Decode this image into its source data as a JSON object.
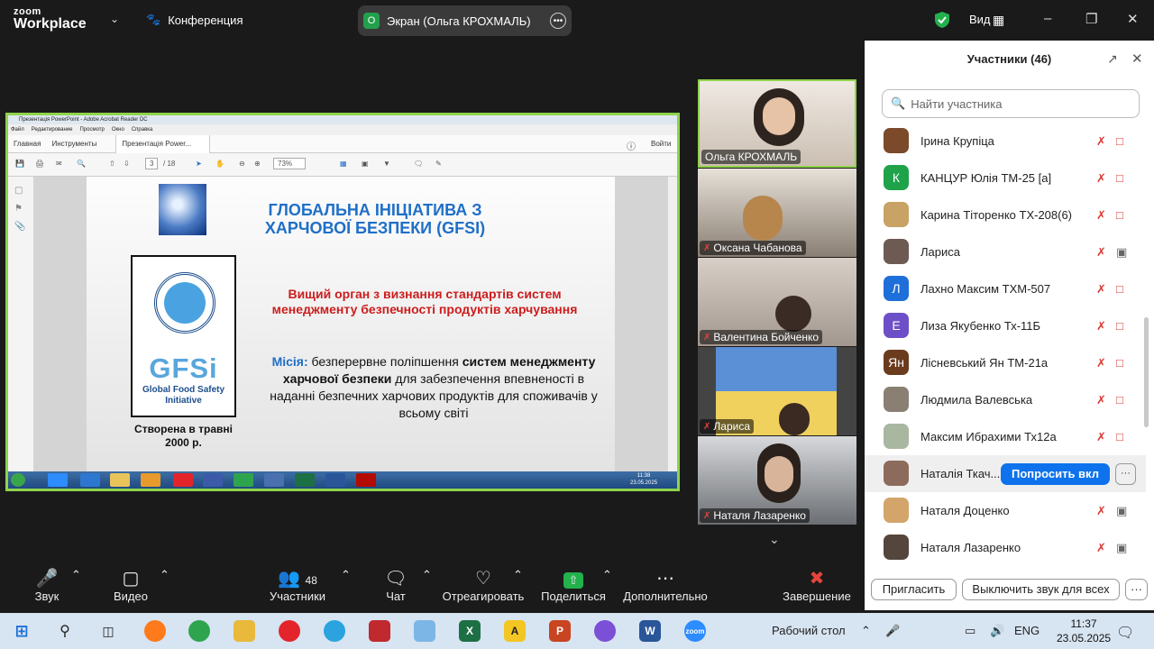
{
  "topbar": {
    "logo_line1": "zoom",
    "logo_line2": "Workplace",
    "conference_label": "Конференция",
    "screen_share_avatar": "О",
    "screen_share_label": "Экран (Ольга КРОХМАЛЬ)",
    "view_label": "Вид"
  },
  "shared": {
    "window_title": "Презентація PowerPoint - Adobe Acrobat Reader DC",
    "menu": [
      "Файл",
      "Редактирование",
      "Просмотр",
      "Окно",
      "Справка"
    ],
    "tab_home": "Главная",
    "tab_tools": "Инструменты",
    "tab_doc": "Презентація Power...",
    "signin": "Войти",
    "page_current": "3",
    "page_total": "/ 18",
    "zoom": "73%",
    "taskbar_time": "11:38",
    "taskbar_date": "23.05.2025",
    "slide": {
      "title": "ГЛОБАЛЬНА ІНІЦІАТИВА З ХАРЧОВОЇ БЕЗПЕКИ (GFSI)",
      "logo_name": "GFSi",
      "logo_sub": "Global Food Safety Initiative",
      "created": "Створена в травні 2000 р.",
      "red_text": "Вищий орган з визнання стандартів систем менеджменту безпечності продуктів харчування",
      "mission_label": "Місія:",
      "mission_a": " безперервне поліпшення ",
      "mission_b": "систем менеджменту харчової безпеки",
      "mission_c": " для забезпечення впевненості в наданні безпечних харчових продуктів для споживачів у всьому світі"
    }
  },
  "videos": [
    {
      "name": "Ольга КРОХМАЛЬ",
      "muted": false,
      "bg": "#cfc6bd"
    },
    {
      "name": "Оксана Чабанова",
      "muted": true,
      "bg": "#8a7f73"
    },
    {
      "name": "Валентина Бойченко",
      "muted": true,
      "bg": "#b8aea6"
    },
    {
      "name": "Лариса",
      "muted": true,
      "bg": "#6f9ad0"
    },
    {
      "name": "Наталя Лазаренко",
      "muted": true,
      "bg": "#6b6e72"
    }
  ],
  "panel": {
    "title": "Участники (46)",
    "search_placeholder": "Найти участника",
    "participants": [
      {
        "name": "Ірина Крупіца",
        "initial": "",
        "color": "#7a4a2a",
        "cam": "off"
      },
      {
        "name": "КАНЦУР Юлія ТМ-25 [а]",
        "initial": "К",
        "color": "#1ea34a",
        "cam": "off"
      },
      {
        "name": "Карина Тіторенко ТХ-208(6)",
        "initial": "",
        "color": "#c9a265",
        "cam": "off"
      },
      {
        "name": "Лариса",
        "initial": "",
        "color": "#6d5a52",
        "cam": "on"
      },
      {
        "name": "Лахно Максим ТХМ-507",
        "initial": "Л",
        "color": "#1e6fd9",
        "cam": "off"
      },
      {
        "name": "Лиза Якубенко Тх-11Б",
        "initial": "Е",
        "color": "#6d4fc7",
        "cam": "off"
      },
      {
        "name": "Лісневський Ян ТМ-21а",
        "initial": "Ян",
        "color": "#6b3b1d",
        "cam": "off"
      },
      {
        "name": "Людмила Валевська",
        "initial": "",
        "color": "#8a7f73",
        "cam": "off"
      },
      {
        "name": "Максим Ибрахими Тх12а",
        "initial": "",
        "color": "#a9b7a0",
        "cam": "off"
      },
      {
        "name": "Наталія Ткач...",
        "initial": "",
        "color": "#8d6b5c",
        "cam": "off"
      },
      {
        "name": "Наталя Доценко",
        "initial": "",
        "color": "#d3a56b",
        "cam": "on"
      },
      {
        "name": "Наталя Лазаренко",
        "initial": "",
        "color": "#54463c",
        "cam": "on"
      }
    ],
    "ask_button": "Попросить вкл",
    "ask_more": "···",
    "invite": "Пригласить",
    "mute_all": "Выключить звук для всех",
    "more": "···"
  },
  "controls": {
    "audio": "Звук",
    "video": "Видео",
    "participants": "Участники",
    "participants_count": "48",
    "chat": "Чат",
    "react": "Отреагировать",
    "share": "Поделиться",
    "more": "Дополнительно",
    "end": "Завершение"
  },
  "taskbar": {
    "desktop": "Рабочий стол",
    "lang": "ENG",
    "time": "11:37",
    "date": "23.05.2025"
  }
}
